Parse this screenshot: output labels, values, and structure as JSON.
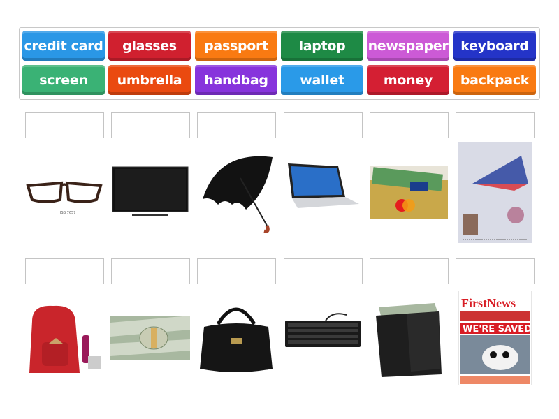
{
  "keywords": [
    {
      "label": "credit card",
      "color": "#2a97e6"
    },
    {
      "label": "glasses",
      "color": "#d0202f"
    },
    {
      "label": "passport",
      "color": "#f97a12"
    },
    {
      "label": "laptop",
      "color": "#1e8a45"
    },
    {
      "label": "newspaper",
      "color": "#cc5ad6"
    },
    {
      "label": "keyboard",
      "color": "#2434c8"
    },
    {
      "label": "screen",
      "color": "#3ab275"
    },
    {
      "label": "umbrella",
      "color": "#ea4a10"
    },
    {
      "label": "handbag",
      "color": "#8734dc"
    },
    {
      "label": "wallet",
      "color": "#2a9ae8"
    },
    {
      "label": "money",
      "color": "#d41f33"
    },
    {
      "label": "backpack",
      "color": "#f97a12"
    }
  ],
  "targets_row1": [
    "glasses-image",
    "screen-image",
    "umbrella-image",
    "laptop-image",
    "credit-card-image",
    "passport-image"
  ],
  "targets_row2": [
    "backpack-image",
    "money-image",
    "handbag-image",
    "keyboard-image",
    "wallet-image",
    "newspaper-image"
  ],
  "newspaper": {
    "masthead": "FirstNews",
    "headline": "WE'RE SAVED!"
  }
}
